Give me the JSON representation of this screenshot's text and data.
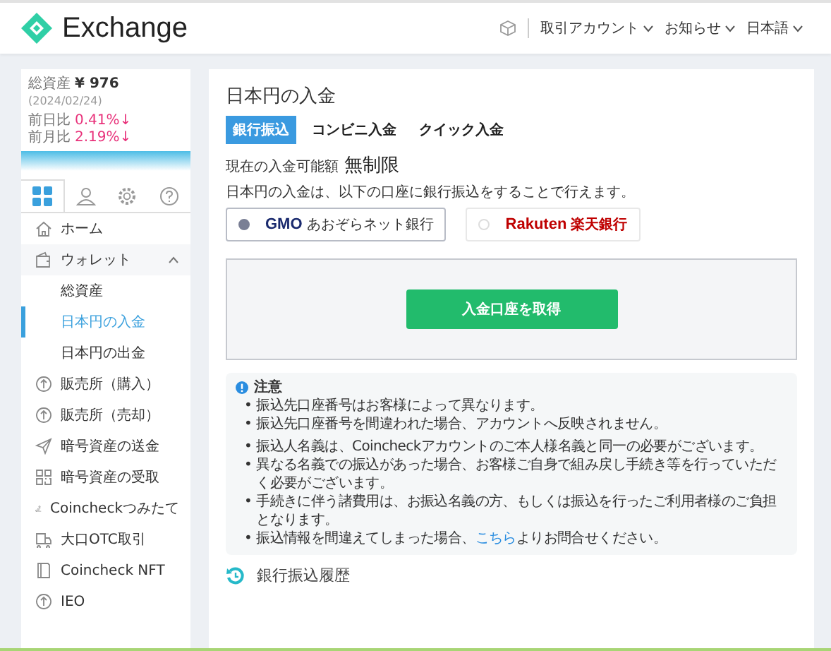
{
  "header": {
    "logo": "Exchange",
    "menus": [
      {
        "label": "取引アカウント"
      },
      {
        "label": "お知らせ"
      },
      {
        "label": "日本語"
      }
    ]
  },
  "summary": {
    "total_label": "総資産",
    "total_value": "¥ 976",
    "date": "(2024/02/24)",
    "changes": [
      {
        "label": "前日比",
        "value": "0.41%↓"
      },
      {
        "label": "前月比",
        "value": "2.19%↓"
      }
    ]
  },
  "sidebar_tabs": [
    {
      "selected": true
    },
    {
      "selected": false
    },
    {
      "selected": false
    },
    {
      "selected": false
    }
  ],
  "sidebar": {
    "items": [
      {
        "label": "ホーム",
        "selected": false
      },
      {
        "label": "ウォレット",
        "selected": false,
        "expanded": true,
        "children": [
          {
            "label": "総資産",
            "selected": false
          },
          {
            "label": "日本円の入金",
            "selected": true
          },
          {
            "label": "日本円の出金",
            "selected": false
          }
        ]
      },
      {
        "label": "販売所（購入）",
        "selected": false
      },
      {
        "label": "販売所（売却）",
        "selected": false
      },
      {
        "label": "暗号資産の送金",
        "selected": false
      },
      {
        "label": "暗号資産の受取",
        "selected": false
      },
      {
        "label": "Coincheckつみたて",
        "selected": false
      },
      {
        "label": "大口OTC取引",
        "selected": false
      },
      {
        "label": "Coincheck NFT",
        "selected": false
      },
      {
        "label": "IEO",
        "selected": false
      }
    ]
  },
  "main": {
    "title": "日本円の入金",
    "tabs": [
      {
        "label": "銀行振込",
        "selected": true
      },
      {
        "label": "コンビニ入金",
        "selected": false
      },
      {
        "label": "クイック入金",
        "selected": false
      }
    ],
    "limit_label": "現在の入金可能額",
    "limit_value": "無制限",
    "description": "日本円の入金は、以下の口座に銀行振込をすることで行えます。",
    "banks": [
      {
        "kind": "gmo",
        "brand": "GMO",
        "name": "あおぞらネット銀行",
        "selected": true
      },
      {
        "kind": "rakuten",
        "brand": "Rakuten",
        "name": "楽天銀行",
        "selected": false
      }
    ],
    "action_button": "入金口座を取得",
    "notice": {
      "title": "注意",
      "groups": [
        [
          {
            "bullet": "•",
            "text": "振込先口座番号はお客様によって異なります。"
          },
          {
            "bullet": "•",
            "text": "振込先口座番号を間違われた場合、アカウントへ反映されません。"
          }
        ],
        [
          {
            "bullet": "•",
            "text": "振込人名義は、Coincheckアカウントのご本人様名義と同一の必要がございます。"
          },
          {
            "bullet": "•",
            "text": "異なる名義での振込があった場合、お客様ご自身で組み戻し手続き等を行っていただく必要がございます。"
          },
          {
            "bullet": "•",
            "text": "手続きに伴う諸費用は、お振込名義の方、もしくは振込を行ったご利用者様のご負担となります。"
          },
          {
            "bullet": "•",
            "text": "振込情報を間違えてしまった場合、",
            "link": "こちら",
            "after": "よりお問合せください。"
          }
        ]
      ]
    },
    "history_title": "銀行振込履歴"
  }
}
